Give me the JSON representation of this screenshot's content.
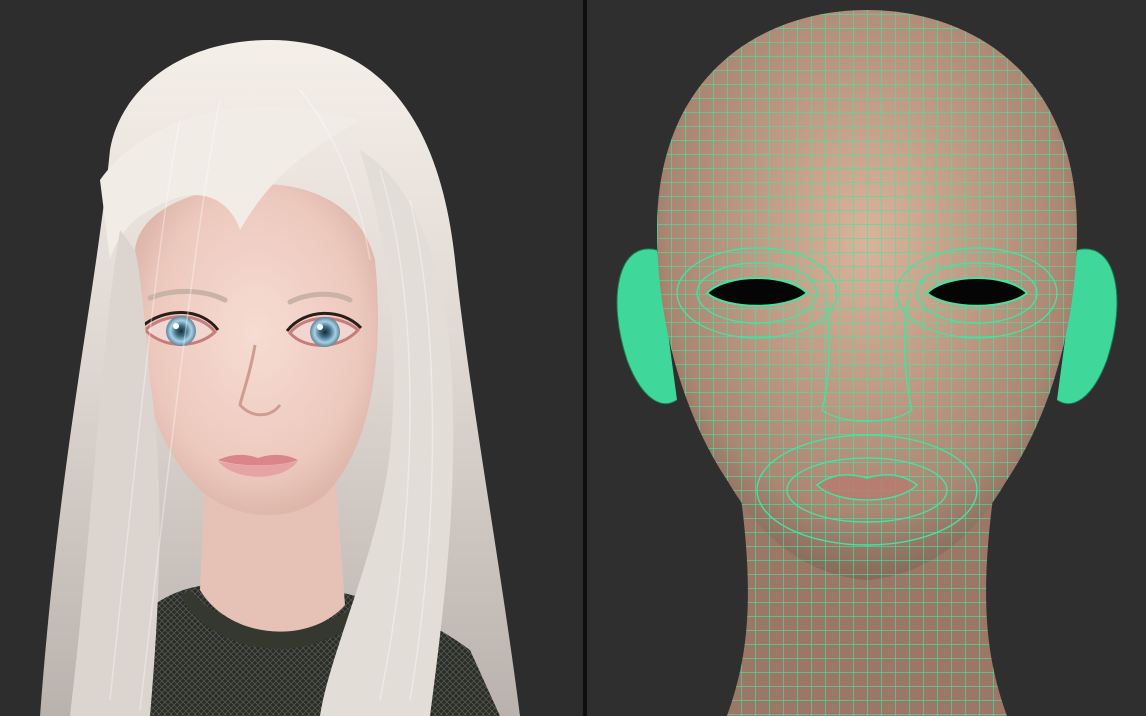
{
  "panels": [
    {
      "id": "render",
      "subject": "rendered-portrait"
    },
    {
      "id": "wireframe",
      "subject": "head-topology-mesh"
    }
  ],
  "colors": {
    "background_left": "#2d2d2d",
    "background_right": "#2f2f2f",
    "divider": "#0e0e0e",
    "hair": "#e8e2dc",
    "skin": "#f0d2c8",
    "iris": "#9fc6da",
    "lips": "#e39a9c",
    "shirt": "#2b2e29",
    "mesh_skin": "#c8a08a",
    "wire": "#43e3a1"
  }
}
